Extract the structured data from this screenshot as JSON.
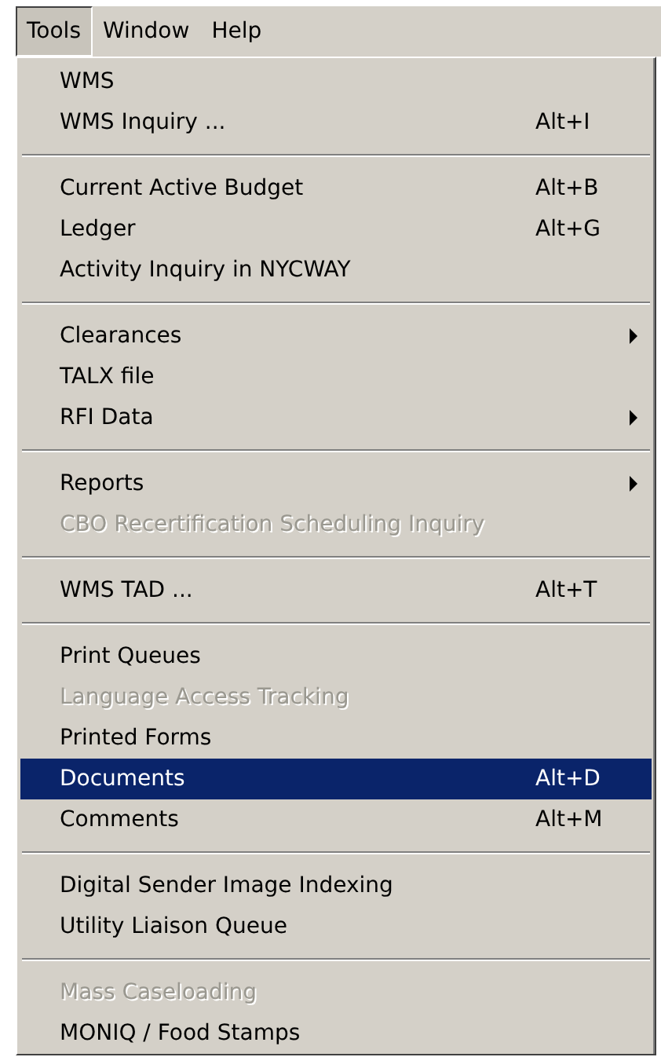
{
  "menubar": [
    {
      "label": "Tools",
      "selected": true
    },
    {
      "label": "Window",
      "selected": false
    },
    {
      "label": "Help",
      "selected": false
    }
  ],
  "menu": {
    "sections": [
      [
        {
          "label": "WMS",
          "submenu": false,
          "disabled": false,
          "selected": false
        },
        {
          "label": "WMS Inquiry ...",
          "shortcut": "Alt+I",
          "submenu": false,
          "disabled": false,
          "selected": false
        }
      ],
      [
        {
          "label": "Current Active Budget",
          "shortcut": "Alt+B",
          "submenu": false,
          "disabled": false,
          "selected": false
        },
        {
          "label": "Ledger",
          "shortcut": "Alt+G",
          "submenu": false,
          "disabled": false,
          "selected": false
        },
        {
          "label": "Activity Inquiry in NYCWAY",
          "submenu": false,
          "disabled": false,
          "selected": false
        }
      ],
      [
        {
          "label": "Clearances",
          "submenu": true,
          "disabled": false,
          "selected": false
        },
        {
          "label": "TALX file",
          "submenu": false,
          "disabled": false,
          "selected": false
        },
        {
          "label": "RFI Data",
          "submenu": true,
          "disabled": false,
          "selected": false
        }
      ],
      [
        {
          "label": "Reports",
          "submenu": true,
          "disabled": false,
          "selected": false
        },
        {
          "label": "CBO Recertification Scheduling Inquiry",
          "submenu": false,
          "disabled": true,
          "selected": false
        }
      ],
      [
        {
          "label": "WMS TAD ...",
          "shortcut": "Alt+T",
          "submenu": false,
          "disabled": false,
          "selected": false
        }
      ],
      [
        {
          "label": "Print Queues",
          "submenu": false,
          "disabled": false,
          "selected": false
        },
        {
          "label": "Language Access Tracking",
          "submenu": false,
          "disabled": true,
          "selected": false
        },
        {
          "label": "Printed Forms",
          "submenu": false,
          "disabled": false,
          "selected": false
        },
        {
          "label": "Documents",
          "shortcut": "Alt+D",
          "submenu": false,
          "disabled": false,
          "selected": true
        },
        {
          "label": "Comments",
          "shortcut": "Alt+M",
          "submenu": false,
          "disabled": false,
          "selected": false
        }
      ],
      [
        {
          "label": "Digital Sender Image Indexing",
          "submenu": false,
          "disabled": false,
          "selected": false
        },
        {
          "label": "Utility Liaison Queue",
          "submenu": false,
          "disabled": false,
          "selected": false
        }
      ],
      [
        {
          "label": "Mass Caseloading",
          "submenu": false,
          "disabled": true,
          "selected": false
        },
        {
          "label": "MONIQ / Food Stamps",
          "submenu": false,
          "disabled": false,
          "selected": false
        }
      ]
    ]
  }
}
